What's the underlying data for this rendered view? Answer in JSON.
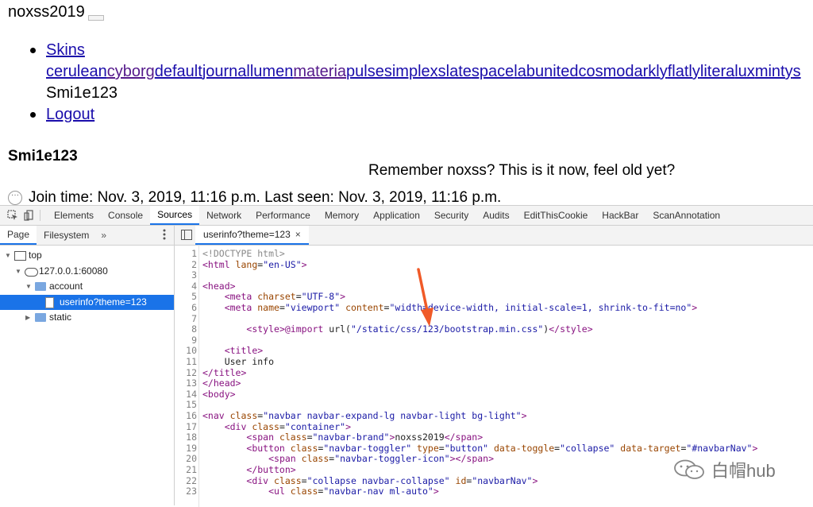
{
  "page": {
    "brand": "noxss2019",
    "nav": {
      "skins_label": "Skins",
      "skins_links": [
        "cerulean",
        "cyborg",
        "default",
        "journal",
        "lumen",
        "materia",
        "pulse",
        "simplex",
        "slate",
        "space",
        "lab",
        "united",
        "cosmo",
        "darkly",
        "flatly",
        "litera",
        "lux",
        "minty",
        "s"
      ],
      "username": "Smi1e123",
      "logout_label": "Logout"
    },
    "heading": "Smi1e123",
    "tagline": "Remember noxss? This is it now, feel old yet?",
    "join_line": "Join time: Nov. 3, 2019, 11:16 p.m. Last seen: Nov. 3, 2019, 11:16 p.m."
  },
  "devtools": {
    "tabs": [
      "Elements",
      "Console",
      "Sources",
      "Network",
      "Performance",
      "Memory",
      "Application",
      "Security",
      "Audits",
      "EditThisCookie",
      "HackBar",
      "ScanAnnotation"
    ],
    "active_tab": "Sources",
    "navigator": {
      "tabs": [
        "Page",
        "Filesystem"
      ],
      "more": "»",
      "tree": [
        {
          "label": "top",
          "icon": "frame-icon",
          "level": 0,
          "expanded": true
        },
        {
          "label": "127.0.0.1:60080",
          "icon": "cloud-icon",
          "level": 1,
          "expanded": true
        },
        {
          "label": "account",
          "icon": "folder-icon",
          "level": 2,
          "expanded": true
        },
        {
          "label": "userinfo?theme=123",
          "icon": "file-icon",
          "level": 3,
          "selected": true
        },
        {
          "label": "static",
          "icon": "folder-icon",
          "level": 2,
          "expanded": false
        }
      ]
    },
    "editor": {
      "file_tab": "userinfo?theme=123",
      "close": "×",
      "lines": [
        "<!DOCTYPE html>",
        "<html lang=\"en-US\">",
        "",
        "<head>",
        "    <meta charset=\"UTF-8\">",
        "    <meta name=\"viewport\" content=\"width=device-width, initial-scale=1, shrink-to-fit=no\">",
        "",
        "        <style>@import url(\"/static/css/123/bootstrap.min.css\")</style>",
        "",
        "    <title>",
        "    User info",
        "</title>",
        "</head>",
        "<body>",
        "",
        "<nav class=\"navbar navbar-expand-lg navbar-light bg-light\">",
        "    <div class=\"container\">",
        "        <span class=\"navbar-brand\">noxss2019</span>",
        "        <button class=\"navbar-toggler\" type=\"button\" data-toggle=\"collapse\" data-target=\"#navbarNav\">",
        "            <span class=\"navbar-toggler-icon\"></span>",
        "        </button>",
        "        <div class=\"collapse navbar-collapse\" id=\"navbarNav\">",
        "            <ul class=\"navbar-nav ml-auto\">"
      ]
    }
  },
  "watermark": "白帽hub",
  "colors": {
    "accent": "#1a73e8",
    "arrow": "#f05a28",
    "link": "#1a0dab"
  }
}
